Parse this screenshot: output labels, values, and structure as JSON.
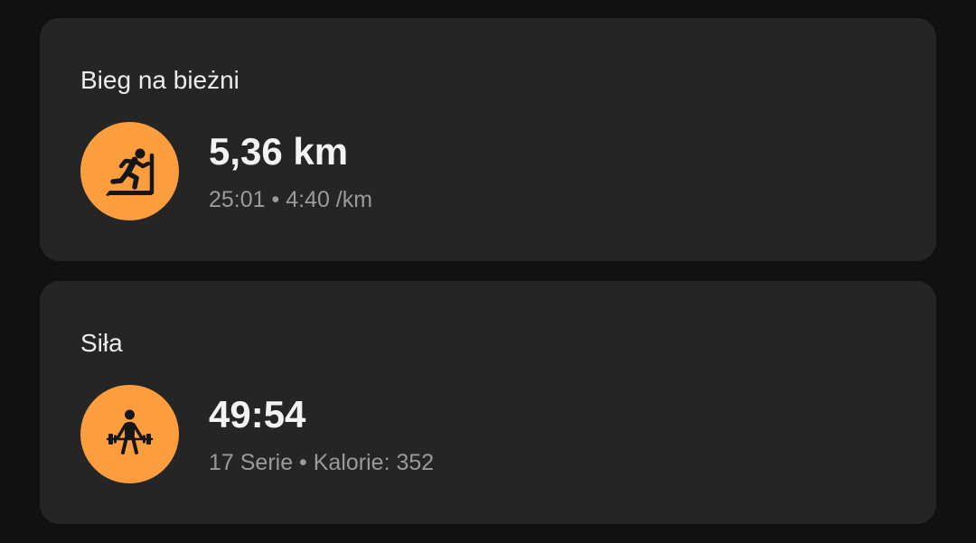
{
  "colors": {
    "background": "#111111",
    "card_background": "#252525",
    "accent_orange": "#fc9e3e",
    "primary_text": "#f3f3f3",
    "secondary_text": "#9a9a9a"
  },
  "activities": [
    {
      "title": "Bieg na bieżni",
      "icon": "treadmill-running-icon",
      "main_value": "5,36 km",
      "details": "25:01 • 4:40 /km"
    },
    {
      "title": "Siła",
      "icon": "weightlifting-icon",
      "main_value": "49:54",
      "details": "17 Serie • Kalorie: 352"
    }
  ]
}
